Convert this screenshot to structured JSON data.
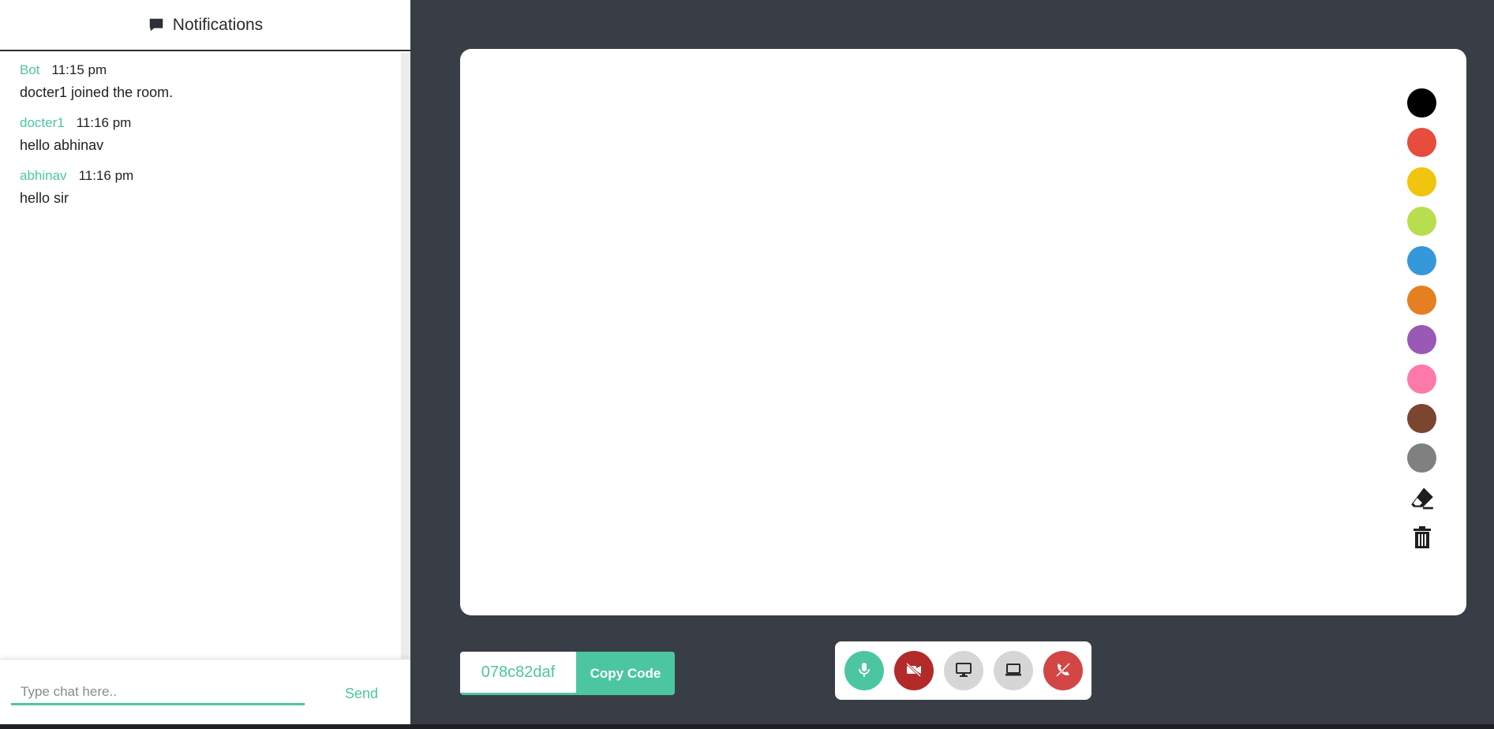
{
  "chat": {
    "header_title": "Notifications",
    "header_icon": "chat-bubble-icon",
    "messages": [
      {
        "author": "Bot",
        "time": "11:15 pm",
        "text": "docter1 joined the room."
      },
      {
        "author": "docter1",
        "time": "11:16 pm",
        "text": "hello abhinav"
      },
      {
        "author": "abhinav",
        "time": "11:16 pm",
        "text": "hello sir"
      }
    ],
    "input_placeholder": "Type chat here..",
    "send_label": "Send"
  },
  "whiteboard": {
    "colors": [
      "#000000",
      "#e74c3c",
      "#f1c40f",
      "#b8de4f",
      "#3498db",
      "#e67e22",
      "#9b59b6",
      "#fd79a8",
      "#7b4530",
      "#808080"
    ],
    "tools": [
      "eraser-icon",
      "trash-icon"
    ]
  },
  "room": {
    "code": "078c82daf",
    "copy_label": "Copy Code"
  },
  "controls": [
    {
      "name": "mic-button",
      "icon": "microphone-icon",
      "bg": "#4cc6a0"
    },
    {
      "name": "video-button",
      "icon": "video-off-icon",
      "bg": "#b22a2a"
    },
    {
      "name": "screen-share-button",
      "icon": "desktop-icon",
      "bg": "#d6d6d6"
    },
    {
      "name": "whiteboard-button",
      "icon": "laptop-icon",
      "bg": "#d6d6d6"
    },
    {
      "name": "leave-call-button",
      "icon": "phone-hangup-icon",
      "bg": "#d24646"
    }
  ],
  "colors": {
    "accent": "#4cc6a0",
    "background": "#393d46"
  }
}
